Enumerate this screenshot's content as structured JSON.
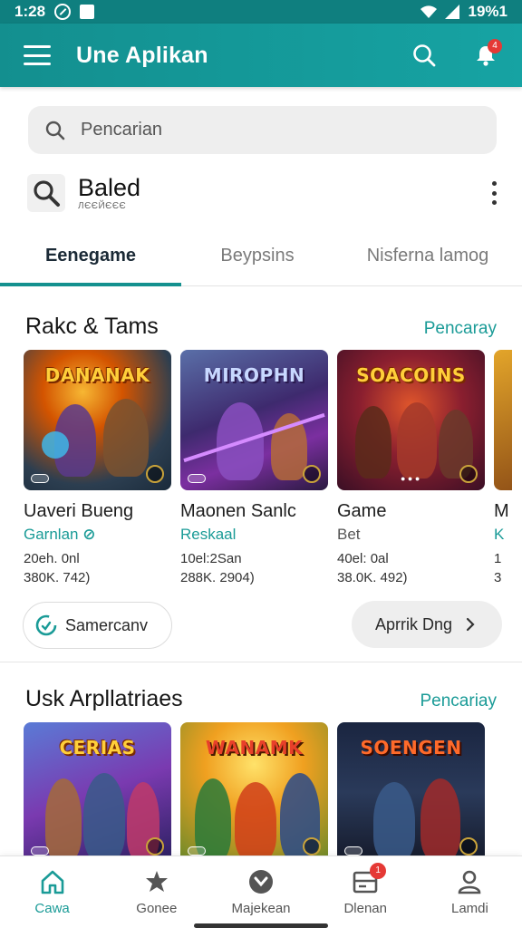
{
  "status_bar": {
    "time": "1:28",
    "right_text": "19%1"
  },
  "app_bar": {
    "title": "Une Aplikan",
    "notification_count": "4"
  },
  "search": {
    "placeholder": "Pencarian"
  },
  "profile": {
    "name": "Baled",
    "subtitle": "ЛЄЄЙЄЄЄ"
  },
  "tabs": [
    {
      "label": "Eenegame",
      "active": true
    },
    {
      "label": "Beypsins",
      "active": false
    },
    {
      "label": "Nisferna lamog",
      "active": false
    }
  ],
  "section1": {
    "title": "Rakc & Tams",
    "link": "Pencaray",
    "cards": [
      {
        "logo": "DANANAK",
        "title": "Uaveri Bueng",
        "subtitle": "Garnlan",
        "meta1": "20eh. 0nl",
        "meta2": "380K. 742)"
      },
      {
        "logo": "MIROPHN",
        "title": "Maonen Sanlc",
        "subtitle": "Reskaal",
        "meta1": "10el:2San",
        "meta2": "288K. 2904)"
      },
      {
        "logo": "SOACOINS",
        "title": "Game",
        "subtitle": "Bet",
        "meta1": "40el: 0al",
        "meta2": "38.0K. 492)"
      },
      {
        "logo": "",
        "title": "M",
        "subtitle": "K",
        "meta1": "1",
        "meta2": "3"
      }
    ]
  },
  "buttons": {
    "left": "Samercanv",
    "right": "Aprrik Dng"
  },
  "section2": {
    "title": "Usk Arpllatriaes",
    "link": "Pencariay",
    "cards": [
      {
        "logo": "CERIAS"
      },
      {
        "logo": "WANAMK"
      },
      {
        "logo": "SOENGEN"
      }
    ]
  },
  "bottom_nav": [
    {
      "label": "Cawa",
      "icon": "home-icon",
      "active": true
    },
    {
      "label": "Gonee",
      "icon": "game-star-icon",
      "active": false
    },
    {
      "label": "Majekean",
      "icon": "check-circle-icon",
      "active": false
    },
    {
      "label": "Dlenan",
      "icon": "library-icon",
      "active": false,
      "badge": "1"
    },
    {
      "label": "Lamdi",
      "icon": "account-icon",
      "active": false
    }
  ],
  "colors": {
    "primary": "#15918f",
    "accent_text": "#1a9b97",
    "badge": "#e53935"
  }
}
